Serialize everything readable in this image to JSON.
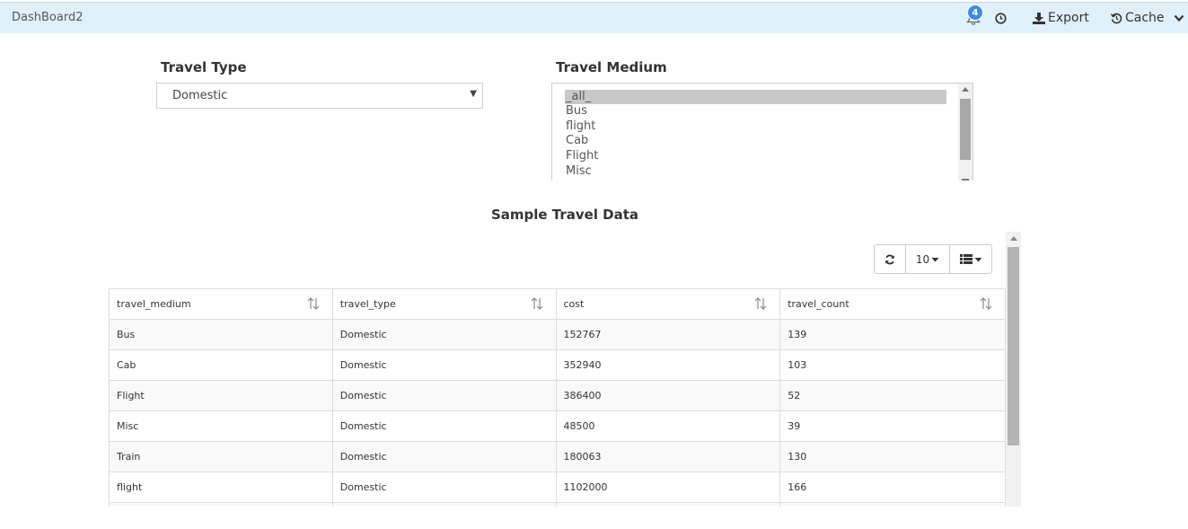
{
  "app": {
    "title": "DashBoard2"
  },
  "header": {
    "notification_count": "4",
    "export_label": "Export",
    "cache_label": "Cache"
  },
  "filters": {
    "travel_type": {
      "label": "Travel Type",
      "value": "Domestic"
    },
    "travel_medium": {
      "label": "Travel Medium",
      "options": [
        "_all_",
        "Bus",
        "flight",
        "Cab",
        "Flight",
        "Misc"
      ],
      "selected": "_all_"
    }
  },
  "table_section": {
    "title": "Sample Travel Data",
    "page_size": "10",
    "columns": [
      "travel_medium",
      "travel_type",
      "cost",
      "travel_count"
    ],
    "rows": [
      [
        "Bus",
        "Domestic",
        "152767",
        "139"
      ],
      [
        "Cab",
        "Domestic",
        "352940",
        "103"
      ],
      [
        "Flight",
        "Domestic",
        "386400",
        "52"
      ],
      [
        "Misc",
        "Domestic",
        "48500",
        "39"
      ],
      [
        "Train",
        "Domestic",
        "180063",
        "130"
      ],
      [
        "flight",
        "Domestic",
        "1102000",
        "166"
      ],
      [
        "",
        "",
        "",
        ""
      ]
    ]
  },
  "icons": {
    "bell": "bell-icon",
    "clock": "clock-icon",
    "export": "download-icon",
    "cache": "history-icon",
    "chevron": "chevron-down-icon",
    "refresh": "refresh-icon",
    "columns": "list-icon",
    "sort": "sort-arrows-icon"
  },
  "colors": {
    "header_bg": "#e0f0fb",
    "badge": "#3c8dde",
    "selection": "#c8c8c8"
  }
}
